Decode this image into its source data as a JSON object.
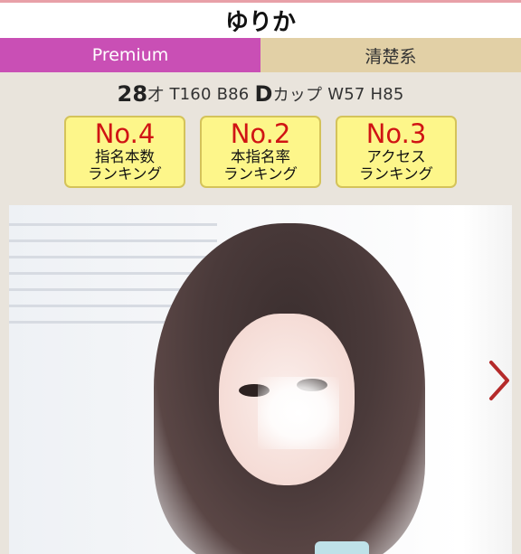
{
  "profile_name": "ゆりか",
  "tags": {
    "premium": "Premium",
    "style": "清楚系"
  },
  "stats": {
    "age": "28",
    "age_unit": "才",
    "height": "T160",
    "bust": "B86",
    "cup_letter": "D",
    "cup_suffix": "カップ",
    "waist": "W57",
    "hip": "H85"
  },
  "rankings": [
    {
      "no": "No.4",
      "line1": "指名本数",
      "line2": "ランキング"
    },
    {
      "no": "No.2",
      "line1": "本指名率",
      "line2": "ランキング"
    },
    {
      "no": "No.3",
      "line1": "アクセス",
      "line2": "ランキング"
    }
  ],
  "colors": {
    "premium_bg": "#c94fb5",
    "style_bg": "#e2d0a6",
    "rank_badge_bg": "#fdf68a",
    "rank_text": "#d01414",
    "arrow": "#b52a2a"
  },
  "icons": {
    "next": "chevron-right-icon"
  }
}
